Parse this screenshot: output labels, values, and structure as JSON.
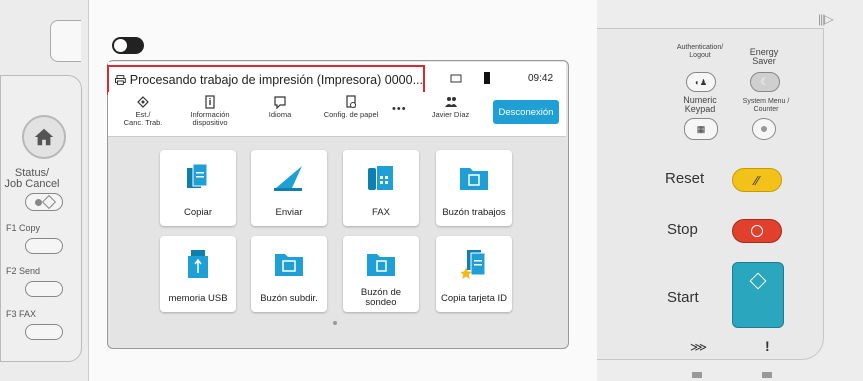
{
  "status_bar": {
    "message": "Procesando trabajo de impresión (Impresora) 0000...",
    "time": "09:42"
  },
  "function_bar": {
    "items": [
      {
        "label": "Est./\nCanc. Trab.",
        "icon": "job-status-icon"
      },
      {
        "label": "Información\ndispositivo",
        "icon": "device-info-icon"
      },
      {
        "label": "Idioma",
        "icon": "language-icon"
      },
      {
        "label": "Config. de papel",
        "icon": "paper-settings-icon"
      }
    ],
    "more": "•••",
    "user": "Javier Díaz",
    "logout": "Desconexión"
  },
  "tiles": [
    {
      "label": "Copiar",
      "icon": "copy-icon"
    },
    {
      "label": "Enviar",
      "icon": "send-icon"
    },
    {
      "label": "FAX",
      "icon": "fax-icon"
    },
    {
      "label": "Buzón trabajos",
      "icon": "job-box-icon"
    },
    {
      "label": "memoria USB",
      "icon": "usb-icon"
    },
    {
      "label": "Buzón subdir.",
      "icon": "subaddress-box-icon"
    },
    {
      "label": "Buzón de\nsondeo",
      "icon": "polling-box-icon"
    },
    {
      "label": "Copia tarjeta ID",
      "icon": "id-card-copy-icon"
    }
  ],
  "left_panel": {
    "status_label": "Status/\nJob Cancel",
    "f1": "F1  Copy",
    "f2": "F2  Send",
    "f3": "F3  FAX"
  },
  "right_panel": {
    "authentication": "Authentication/\nLogout",
    "energy_saver": "Energy\nSaver",
    "numeric_keypad": "Numeric\nKeypad",
    "system_menu": "System Menu /\nCounter",
    "reset": "Reset",
    "stop": "Stop",
    "start": "Start"
  },
  "colors": {
    "accent": "#1e9fd6",
    "highlight": "#e1262d",
    "reset_button": "#f2c21a",
    "stop_button": "#e0402c",
    "start_button": "#2aa6bf"
  }
}
